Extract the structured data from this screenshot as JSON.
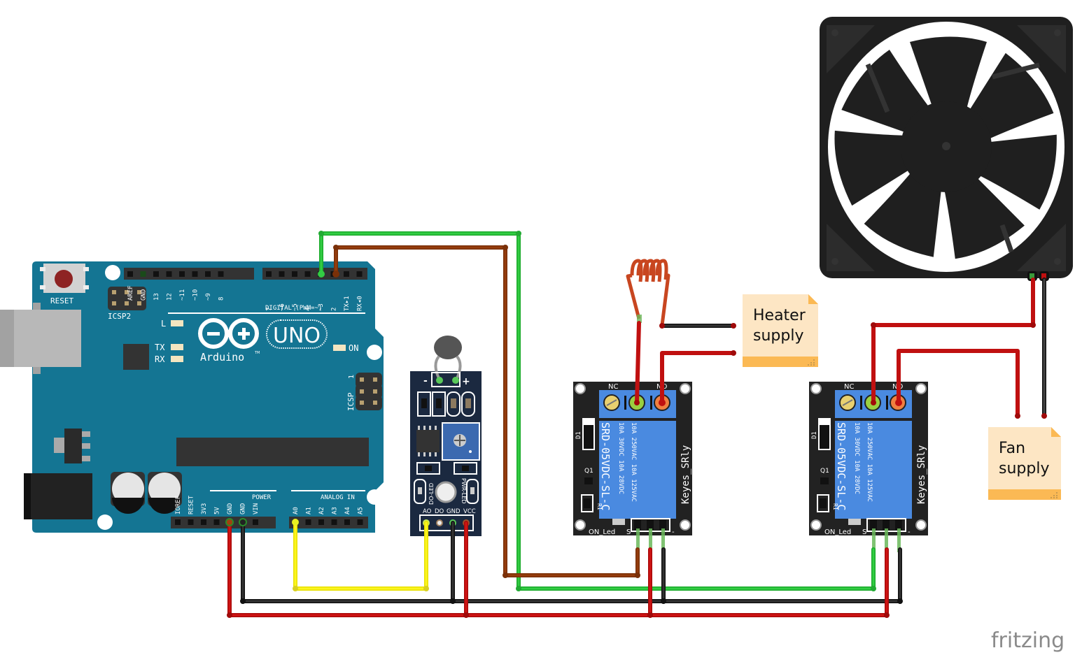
{
  "arduino": {
    "reset_label": "RESET",
    "icsp2_label": "ICSP2",
    "icsp_label": "ICSP",
    "icsp_pin1": "1",
    "brand": "Arduino",
    "tm": "TM",
    "model": "UNO",
    "digital_label": "DIGITAL (PWM=~)",
    "power_label": "POWER",
    "analog_label": "ANALOG IN",
    "led_l": "L",
    "led_tx": "TX",
    "led_rx": "RX",
    "led_on": "ON",
    "top_header_a": [
      "AREF",
      "GND",
      "13",
      "12",
      "~11",
      "~10",
      "~9",
      "8"
    ],
    "top_header_b": [
      "7",
      "~6",
      "~5",
      "4",
      "~3",
      "2",
      "TX▸1",
      "RX◂0"
    ],
    "power_pins": [
      "IOREF",
      "RESET",
      "3V3",
      "5V",
      "GND",
      "GND",
      "VIN"
    ],
    "analog_pins": [
      "A0",
      "A1",
      "A2",
      "A3",
      "A4",
      "A5"
    ]
  },
  "sensor": {
    "minus": "-",
    "plus": "+",
    "do_led": "DO-LED",
    "pwr_led": "PWR-LED",
    "pins": [
      "AO",
      "DO",
      "GND",
      "VCC"
    ]
  },
  "relays": [
    {
      "nc": "NC",
      "no": "NO",
      "d1": "D1",
      "q1": "Q1",
      "r1": "R1",
      "model": "SRD-05VDC-SL-C",
      "rating1": "10A 250VAC  10A 125VAC",
      "rating2": "10A  30VDC  10A  28VDC",
      "brand": "Keyes_SRly",
      "on_led": "ON_Led",
      "s": "S",
      "minus": "-"
    },
    {
      "nc": "NC",
      "no": "NO",
      "d1": "D1",
      "q1": "Q1",
      "r1": "R1",
      "model": "SRD-05VDC-SL-C",
      "rating1": "10A 250VAC  10A 125VAC",
      "rating2": "10A  30VDC  10A  28VDC",
      "brand": "Keyes_SRly",
      "on_led": "ON_Led",
      "s": "S",
      "minus": "-"
    }
  ],
  "notes": {
    "heater": {
      "line1": "Heater",
      "line2": "supply"
    },
    "fan": {
      "line1": "Fan",
      "line2": "supply"
    }
  },
  "watermark": "fritzing",
  "colors": {
    "board_blue": "#147593",
    "wire_red": "#cc1010",
    "wire_black": "#222222",
    "wire_green": "#22bb33",
    "wire_brown": "#8a3a0a",
    "wire_yellow": "#f2ef10",
    "note_bg": "#fde6c4",
    "note_bar": "#fbb954",
    "relay_blue": "#4a8ae0",
    "sensor_navy": "#1b2940"
  }
}
